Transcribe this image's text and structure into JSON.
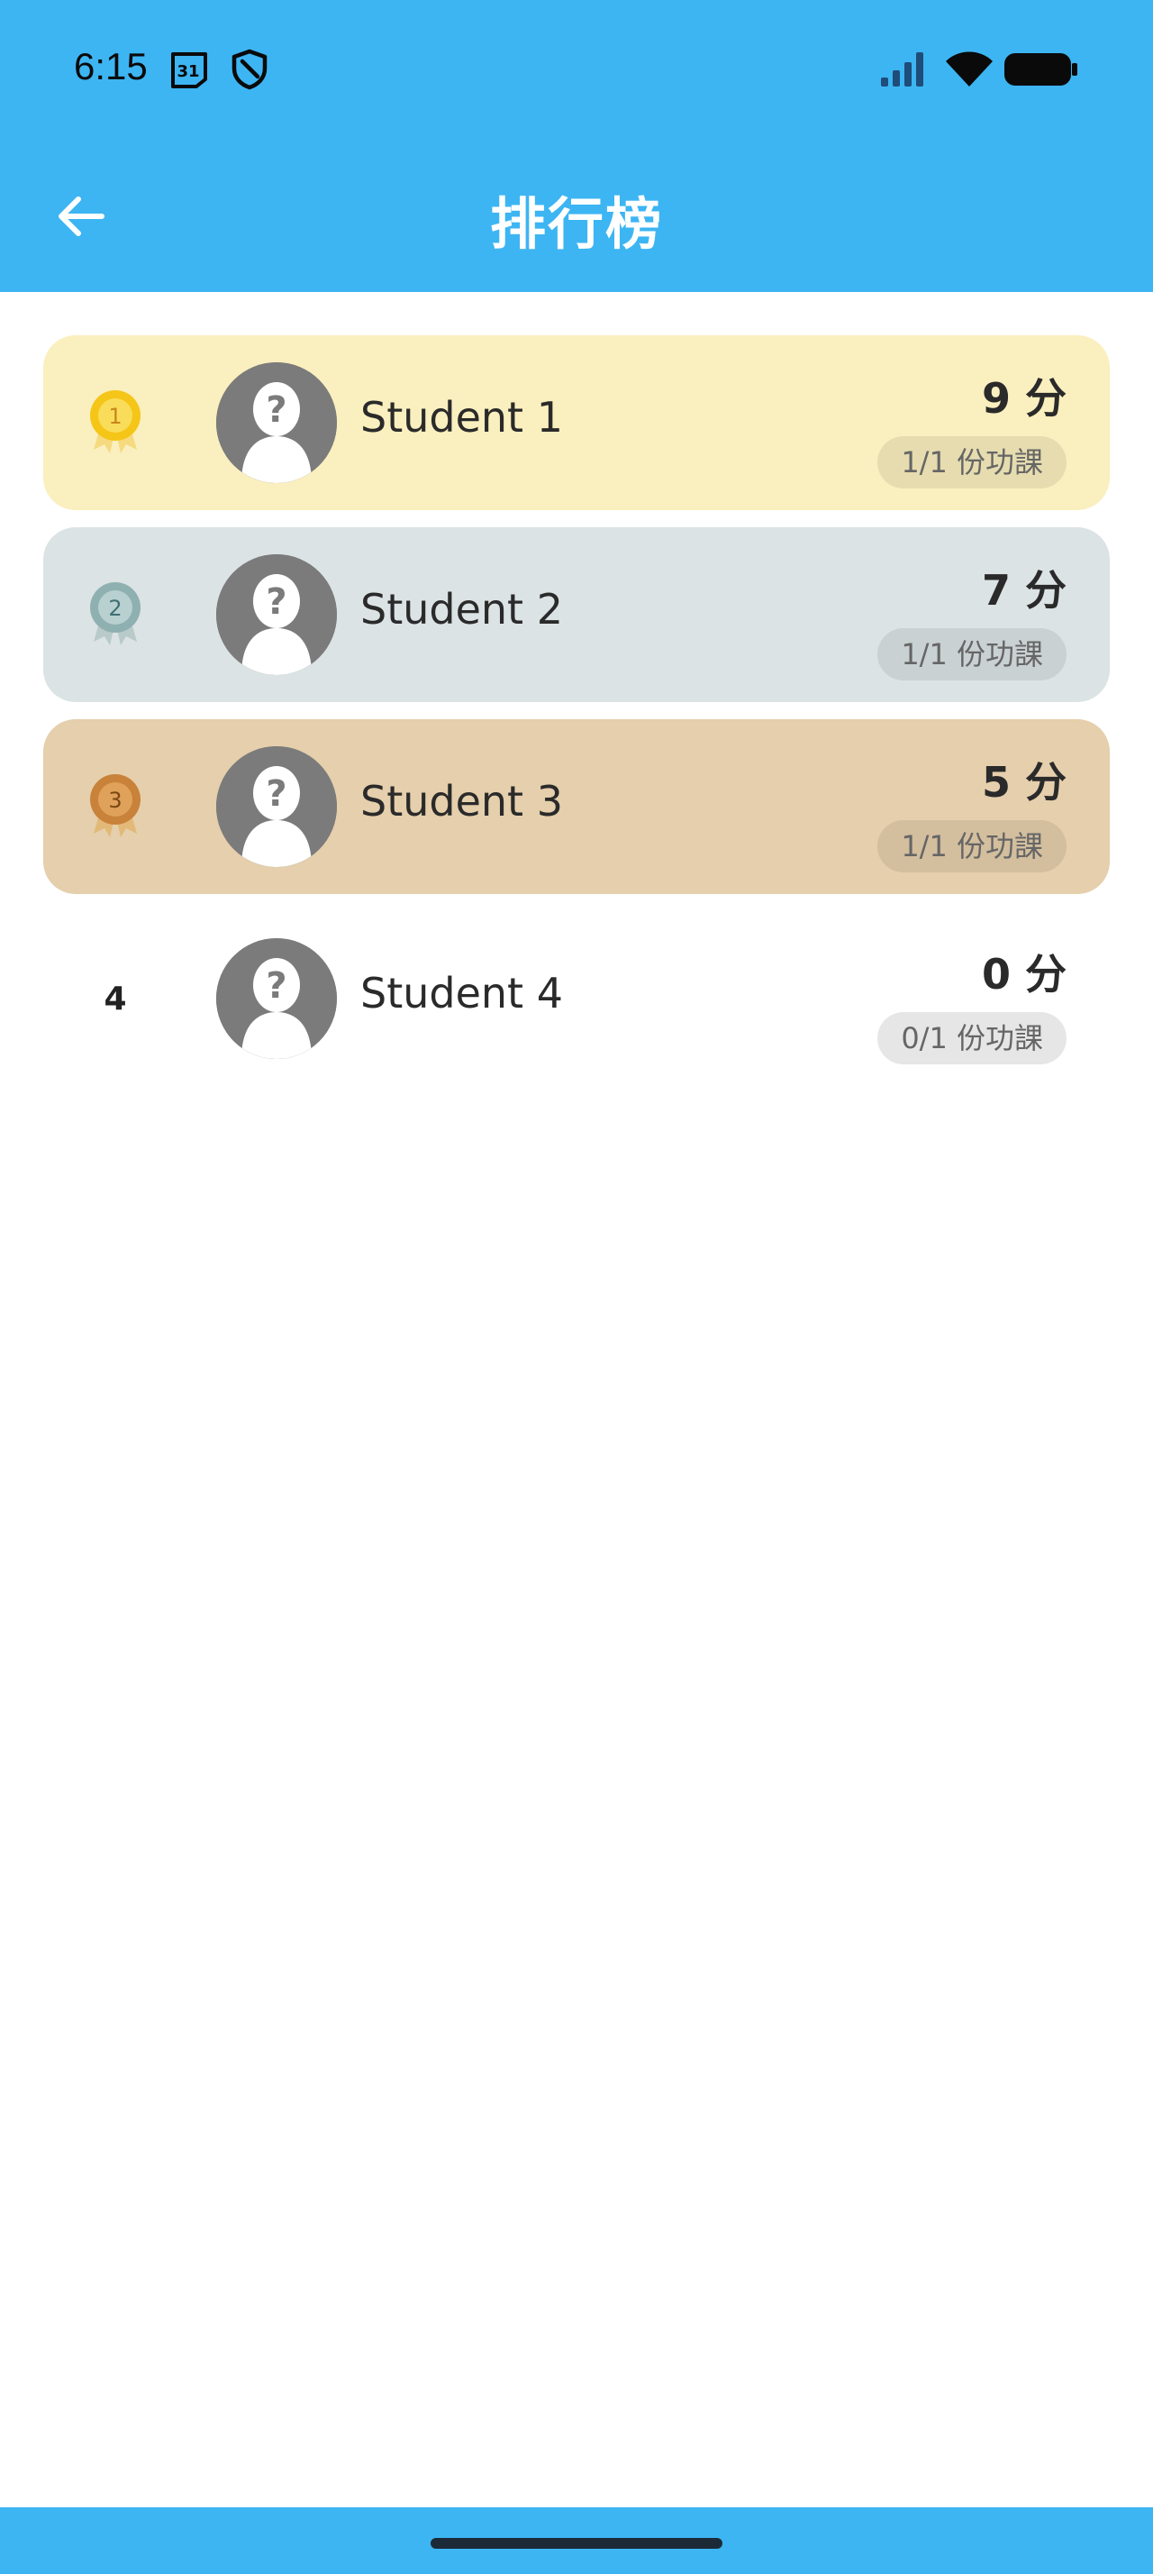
{
  "status_bar": {
    "time": "6:15",
    "icons": [
      "calendar-icon",
      "shield-icon",
      "signal-icon",
      "wifi-icon",
      "battery-icon"
    ],
    "calendar_day": "31"
  },
  "app_bar": {
    "title": "排行榜",
    "back_icon": "arrow-left-icon"
  },
  "colors": {
    "primary": "#3db5f3",
    "gold_row": "#faefbe",
    "silver_row": "#dce3e4",
    "bronze_row": "#e5cfac"
  },
  "leaderboard": [
    {
      "rank": "1",
      "medal": "gold",
      "name": "Student 1",
      "score": "9 分",
      "progress": "1/1 份功課"
    },
    {
      "rank": "2",
      "medal": "silver",
      "name": "Student 2",
      "score": "7 分",
      "progress": "1/1 份功課"
    },
    {
      "rank": "3",
      "medal": "bronze",
      "name": "Student 3",
      "score": "5 分",
      "progress": "1/1 份功課"
    },
    {
      "rank": "4",
      "medal": "",
      "name": "Student 4",
      "score": "0 分",
      "progress": "0/1 份功課"
    }
  ]
}
